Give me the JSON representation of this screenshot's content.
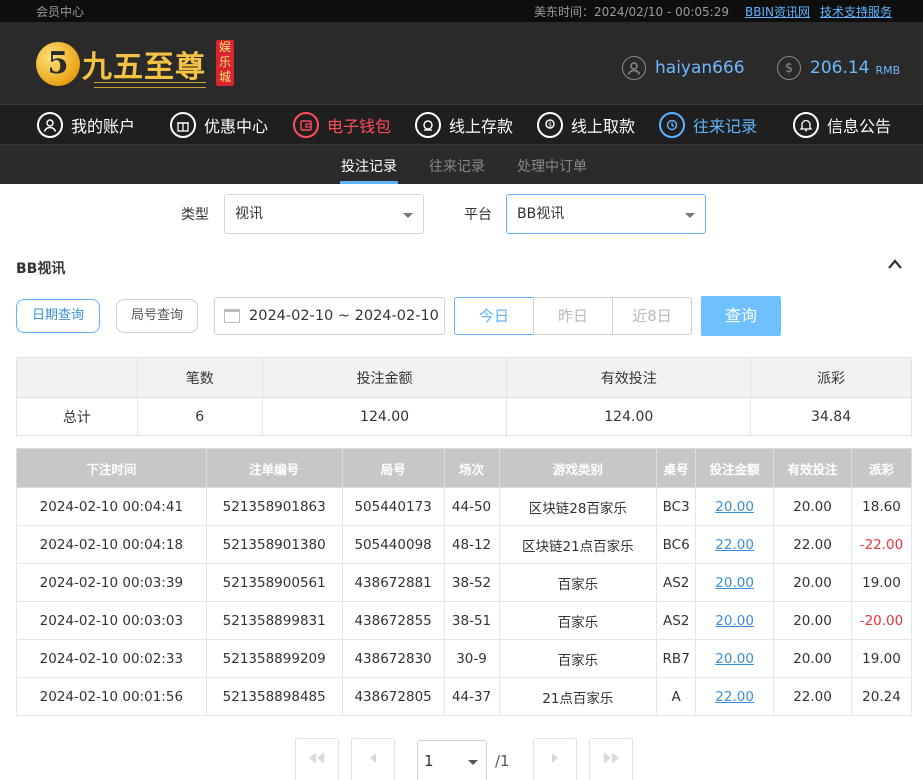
{
  "topbar": {
    "left_label": "会员中心",
    "time_label": "美东时间：2024/02/10 - 00:05:29",
    "link1": "BBIN资讯网",
    "link2": "技术支持服务"
  },
  "brand": {
    "logo_char": "5",
    "name": "九五至尊",
    "badge": "娱乐城"
  },
  "user": {
    "username": "haiyan666",
    "balance": "206.14",
    "currency": "RMB"
  },
  "mainnav": [
    {
      "label": "我的账户",
      "icon": "user-icon"
    },
    {
      "label": "优惠中心",
      "icon": "gift-icon"
    },
    {
      "label": "电子钱包",
      "icon": "wallet-icon"
    },
    {
      "label": "线上存款",
      "icon": "deposit-icon"
    },
    {
      "label": "线上取款",
      "icon": "withdraw-icon"
    },
    {
      "label": "往来记录",
      "icon": "history-icon"
    },
    {
      "label": "信息公告",
      "icon": "bell-icon"
    }
  ],
  "subnav": [
    "投注记录",
    "往来记录",
    "处理中订单"
  ],
  "filters": {
    "type_label": "类型",
    "type_value": "视讯",
    "platform_label": "平台",
    "platform_value": "BB视讯"
  },
  "section": {
    "title": "BB视讯"
  },
  "query": {
    "date_query": "日期查询",
    "round_query": "局号查询",
    "date_range": "2024-02-10 ~ 2024-02-10",
    "today": "今日",
    "yesterday": "昨日",
    "last8": "近8日",
    "submit": "查询"
  },
  "summary": {
    "headers": [
      "",
      "笔数",
      "投注金额",
      "有效投注",
      "派彩"
    ],
    "row": [
      "总计",
      "6",
      "124.00",
      "124.00",
      "34.84"
    ]
  },
  "detail": {
    "headers": [
      "下注时间",
      "注单编号",
      "局号",
      "场次",
      "游戏类别",
      "桌号",
      "投注金额",
      "有效投注",
      "派彩"
    ],
    "rows": [
      [
        "2024-02-10 00:04:41",
        "521358901863",
        "505440173",
        "44-50",
        "区块链28百家乐",
        "BC3",
        "20.00",
        "20.00",
        "18.60"
      ],
      [
        "2024-02-10 00:04:18",
        "521358901380",
        "505440098",
        "48-12",
        "区块链21点百家乐",
        "BC6",
        "22.00",
        "22.00",
        "-22.00"
      ],
      [
        "2024-02-10 00:03:39",
        "521358900561",
        "438672881",
        "38-52",
        "百家乐",
        "AS2",
        "20.00",
        "20.00",
        "19.00"
      ],
      [
        "2024-02-10 00:03:03",
        "521358899831",
        "438672855",
        "38-51",
        "百家乐",
        "AS2",
        "20.00",
        "20.00",
        "-20.00"
      ],
      [
        "2024-02-10 00:02:33",
        "521358899209",
        "438672830",
        "30-9",
        "百家乐",
        "RB7",
        "20.00",
        "20.00",
        "19.00"
      ],
      [
        "2024-02-10 00:01:56",
        "521358898485",
        "438672805",
        "44-37",
        "21点百家乐",
        "A",
        "22.00",
        "22.00",
        "20.24"
      ]
    ]
  },
  "pagination": {
    "page": "1",
    "total": "/1"
  },
  "colors": {
    "accent": "#5fb3ff",
    "negative": "#e8343e",
    "gold": "#f4c343"
  }
}
